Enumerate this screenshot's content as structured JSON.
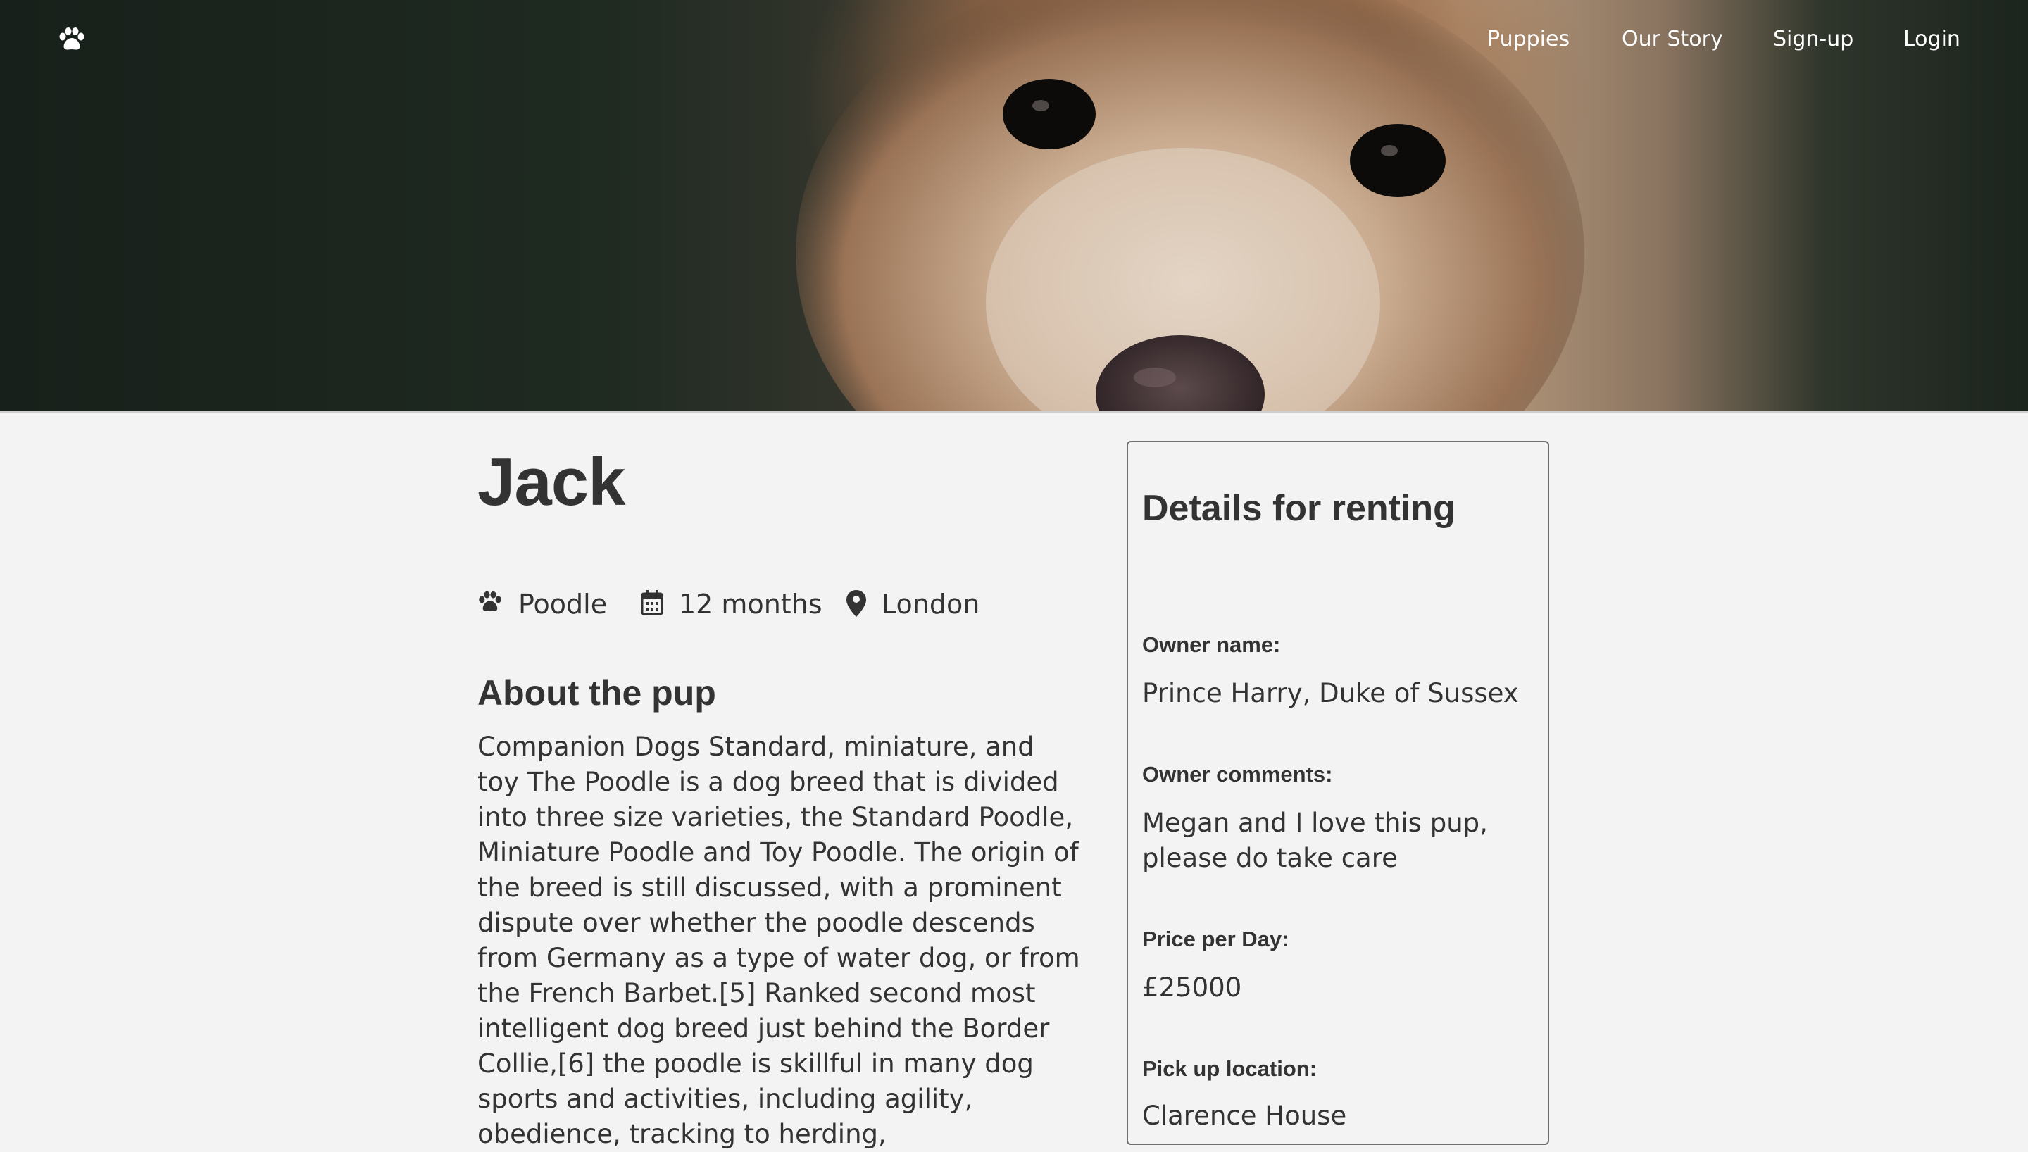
{
  "nav": {
    "logo_icon": "paw-icon",
    "links": [
      "Puppies",
      "Our Story",
      "Sign-up",
      "Login"
    ]
  },
  "hero": {
    "image": "close-up of a brown and cream puppy face"
  },
  "pup": {
    "name": "Jack",
    "breed": "Poodle",
    "age": "12 months",
    "location": "London",
    "about_heading": "About the pup",
    "about_text": "Companion Dogs Standard, miniature, and toy The Poodle is a dog breed that is divided into three size varieties, the Standard Poodle, Miniature Poodle and Toy Poodle. The origin of the breed is still discussed, with a prominent dispute over whether the poodle descends from Germany as a type of water dog, or from the French Barbet.[5] Ranked second most intelligent dog breed just behind the Border Collie,[6] the poodle is skillful in many dog sports and activities, including agility, obedience, tracking to herding,"
  },
  "details": {
    "title": "Details for renting",
    "owner_name_label": "Owner name:",
    "owner_name": "Prince Harry, Duke of Sussex",
    "owner_comments_label": "Owner comments:",
    "owner_comments": "Megan and I love this pup, please do take care",
    "price_label": "Price per Day:",
    "price": "£25000",
    "pickup_label": "Pick up location:",
    "pickup": "Clarence House"
  },
  "colors": {
    "text": "#333333",
    "background": "#f3f3f3",
    "nav_text": "#ffffff",
    "card_border": "#6f6f6f"
  }
}
